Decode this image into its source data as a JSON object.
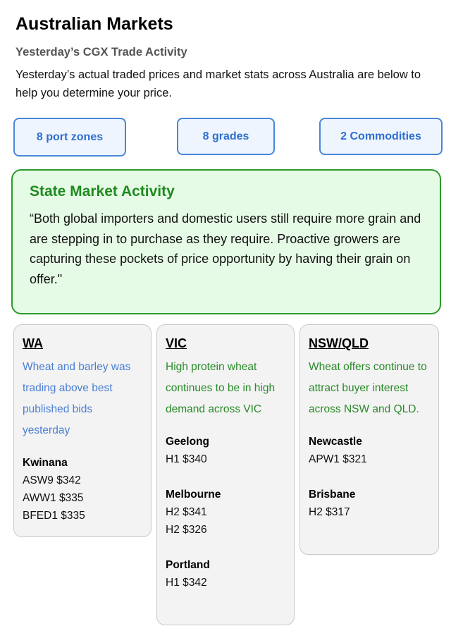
{
  "header": {
    "title": "Australian Markets",
    "subtitle": "Yesterday’s CGX Trade Activity",
    "intro": "Yesterday’s actual traded prices and market stats across Australia are below to help you determine your price."
  },
  "stats": {
    "port_zones": "8 port zones",
    "grades": "8 grades",
    "commodities": "2 Commodities"
  },
  "activity": {
    "title": "State Market Activity",
    "quote": "“Both global importers and domestic users still require more grain and are stepping in to purchase as they require. Proactive growers are capturing these pockets of price opportunity by having their grain on offer.\""
  },
  "regions": {
    "wa": {
      "title": "WA",
      "desc": "Wheat and barley was trading above best published bids yesterday",
      "ports": [
        {
          "name": "Kwinana",
          "prices": [
            "ASW9 $342",
            "AWW1 $335",
            "BFED1 $335"
          ]
        }
      ]
    },
    "vic": {
      "title": "VIC",
      "desc": "High protein wheat continues to be in high demand across VIC",
      "ports": [
        {
          "name": "Geelong",
          "prices": [
            "H1 $340"
          ]
        },
        {
          "name": "Melbourne",
          "prices": [
            "H2 $341",
            "H2 $326"
          ]
        },
        {
          "name": "Portland",
          "prices": [
            "H1 $342"
          ]
        }
      ]
    },
    "nsw": {
      "title": "NSW/QLD",
      "desc": "Wheat offers continue to attract buyer interest across NSW and QLD.",
      "ports": [
        {
          "name": "Newcastle",
          "prices": [
            "APW1 $321"
          ]
        },
        {
          "name": "Brisbane",
          "prices": [
            "H2 $317"
          ]
        }
      ]
    }
  },
  "colors": {
    "button_border": "#4a86d8",
    "button_text": "#2f6fcf",
    "activity_border": "#2c9a2c",
    "activity_bg": "#e6fbe6",
    "wa_desc": "#4a7fd4",
    "green_desc": "#2a8a2a"
  }
}
